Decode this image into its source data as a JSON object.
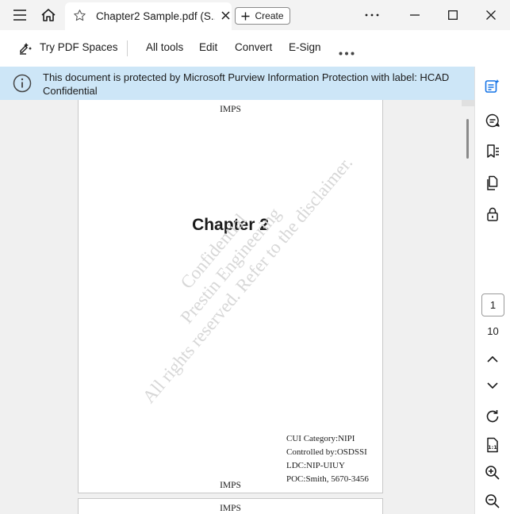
{
  "titlebar": {
    "tab_title": "Chapter2 Sample.pdf (S...",
    "create_label": "Create"
  },
  "toolbar": {
    "try_pdf_spaces": "Try PDF Spaces",
    "all_tools": "All tools",
    "edit": "Edit",
    "convert": "Convert",
    "esign": "E-Sign"
  },
  "banner": {
    "text": "This document is protected by Microsoft Purview Information Protection with label: HCAD Confidential"
  },
  "page": {
    "header": "IMPS",
    "footer": "IMPS",
    "chapter_title": "Chapter 2",
    "watermark_lines": [
      "Confidential",
      "Prestin Engineering",
      "All rights reserved. Refer to the disclaimer."
    ],
    "cui_lines": [
      "CUI Category:NIPI",
      "Controlled by:OSDSSI",
      "LDC:NIP-UIUY",
      "POC:Smith, 5670-3456"
    ],
    "next_page_header": "IMPS"
  },
  "nav": {
    "current_page": "1",
    "total_pages": "10"
  },
  "colors": {
    "banner_bg": "#cde6f7",
    "accent": "#1473e6"
  }
}
